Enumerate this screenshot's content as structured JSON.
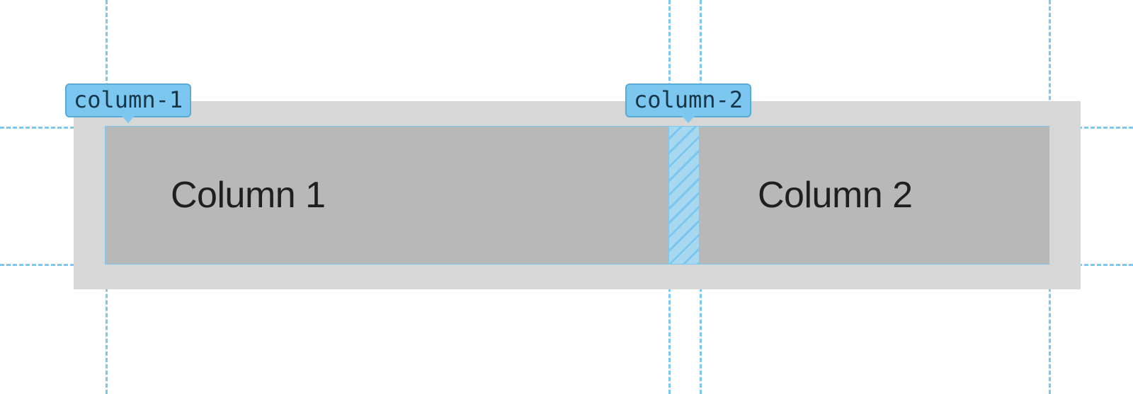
{
  "columns": [
    {
      "name": "column-1",
      "content": "Column 1"
    },
    {
      "name": "column-2",
      "content": "Column 2"
    }
  ],
  "guides": {
    "horizontal": [
      179,
      373
    ],
    "vertical": [
      149,
      944,
      988,
      1481
    ]
  },
  "colors": {
    "guide": "#7cc7f0",
    "container_bg": "#d7d7d7",
    "track_bg": "#b8b8b8",
    "badge_bg": "#7cc7f0",
    "badge_border": "#5aaad6",
    "text": "#1f1f1f"
  }
}
